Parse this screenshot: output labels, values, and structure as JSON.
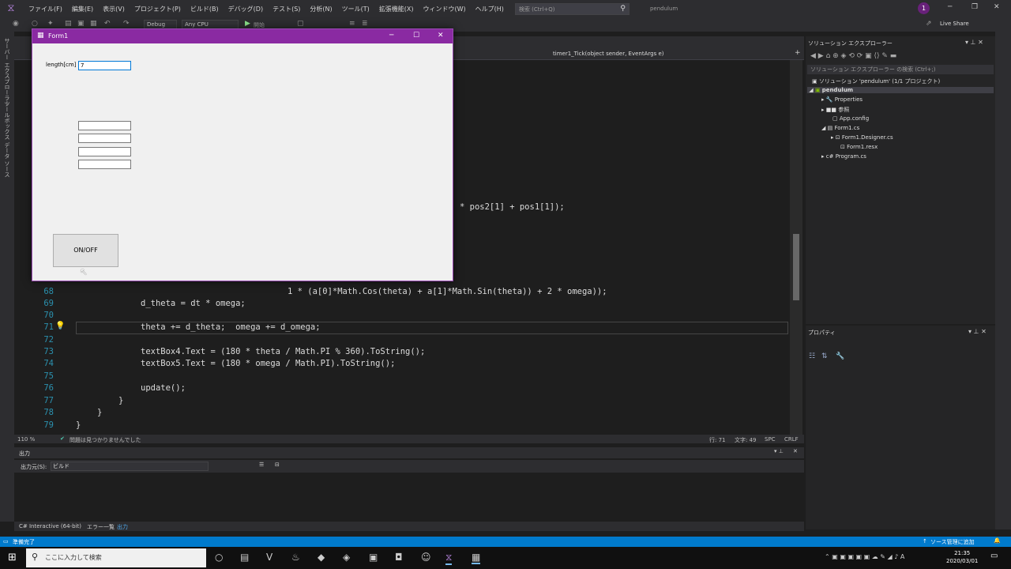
{
  "menubar": {
    "menus": [
      "ファイル(F)",
      "編集(E)",
      "表示(V)",
      "プロジェクト(P)",
      "ビルド(B)",
      "デバッグ(D)",
      "テスト(S)",
      "分析(N)",
      "ツール(T)",
      "拡張機能(X)",
      "ウィンドウ(W)",
      "ヘルプ(H)"
    ],
    "search_placeholder": "検索 (Ctrl+Q)",
    "project_name": "pendulum",
    "notification_count": "1"
  },
  "toolbar": {
    "config": "Debug",
    "platform": "Any CPU",
    "start_label": "開始",
    "live_share": "Live Share"
  },
  "side_tabs": [
    "サーバー エクスプローラー",
    "ツールボックス",
    "データ ソース"
  ],
  "editor": {
    "nav_member": "timer1_Tick(object sender, EventArgs e)",
    "zoom": "110 %",
    "issues": "問題は見つかりませんでした",
    "line": "行: 71",
    "char": "文字: 49",
    "spc": "SPC",
    "crlf": "CRLF",
    "fragment_top": "* pos2[1] + pos1[1]);",
    "lines": [
      {
        "num": "68",
        "text": "1 * (a[0]*Math.Cos(theta) + a[1]*Math.Sin(theta)) + 2 * omega));"
      },
      {
        "num": "69",
        "text": "d_theta = dt * omega;"
      },
      {
        "num": "70",
        "text": ""
      },
      {
        "num": "71",
        "text": "theta += d_theta;  omega += d_omega;"
      },
      {
        "num": "72",
        "text": ""
      },
      {
        "num": "73",
        "text": "textBox4.Text = (180 * theta / Math.PI % 360).ToString();"
      },
      {
        "num": "74",
        "text": "textBox5.Text = (180 * omega / Math.PI).ToString();"
      },
      {
        "num": "75",
        "text": ""
      },
      {
        "num": "76",
        "text": "update();"
      },
      {
        "num": "77",
        "text": "}"
      },
      {
        "num": "78",
        "text": "}"
      },
      {
        "num": "79",
        "text": "}"
      }
    ]
  },
  "output": {
    "title": "出力",
    "source_label": "出力元(S):",
    "source_value": "ビルド",
    "tabs": [
      "C# Interactive (64-bit)",
      "エラー一覧",
      "出力"
    ]
  },
  "solution_explorer": {
    "title": "ソリューション エクスプローラー",
    "search_placeholder": "ソリューション エクスプローラー の検索 (Ctrl+;)",
    "items": [
      {
        "label": "ソリューション 'pendulum' (1/1 プロジェクト)",
        "icon": "solution-icon"
      },
      {
        "label": "pendulum",
        "icon": "csharp-project-icon"
      },
      {
        "label": "Properties",
        "icon": "wrench-icon"
      },
      {
        "label": "参照",
        "icon": "references-icon"
      },
      {
        "label": "App.config",
        "icon": "config-file-icon"
      },
      {
        "label": "Form1.cs",
        "icon": "form-icon"
      },
      {
        "label": "Form1.Designer.cs",
        "icon": "csharp-file-icon"
      },
      {
        "label": "Form1.resx",
        "icon": "resx-icon"
      },
      {
        "label": "Program.cs",
        "icon": "csharp-file-icon"
      }
    ]
  },
  "properties": {
    "title": "プロパティ"
  },
  "status_bar": {
    "ready": "準備完了",
    "source_control": "ソース管理に追加"
  },
  "taskbar": {
    "search_placeholder": "ここに入力して検索",
    "time": "21:35",
    "date": "2020/03/01"
  },
  "form1": {
    "title": "Form1",
    "length_label": "length[cm]",
    "length_value": "7",
    "textbox2": "",
    "textbox3": "",
    "textbox4": "",
    "textbox5": "",
    "button_label": "ON/OFF"
  },
  "colors": {
    "vs_accent": "#68217a",
    "form_title": "#8a2aa2",
    "status_bar": "#007acc"
  }
}
